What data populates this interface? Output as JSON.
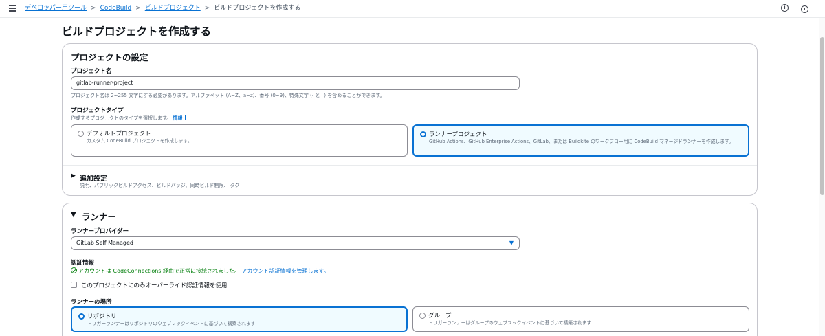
{
  "breadcrumb": {
    "items": [
      "デベロッパー用ツール",
      "CodeBuild",
      "ビルドプロジェクト"
    ],
    "current": "ビルドプロジェクトを作成する"
  },
  "page": {
    "title": "ビルドプロジェクトを作成する"
  },
  "project_settings": {
    "title": "プロジェクトの設定",
    "name_label": "プロジェクト名",
    "name_value": "gitlab-runner-project",
    "name_hint": "プロジェクト名は 2~255 文字にする必要があります。アルファベット (A~Z、a~z)、番号 (0~9)、特殊文字 (- と _) を含めることができます。",
    "type_label": "プロジェクトタイプ",
    "type_hint": "作成するプロジェクトのタイプを選択します。",
    "info_link": "情報",
    "options": [
      {
        "title": "デフォルトプロジェクト",
        "desc": "カスタム CodeBuild プロジェクトを作成します。",
        "selected": false
      },
      {
        "title": "ランナープロジェクト",
        "desc": "GitHub Actions、GitHub Enterprise Actions、GitLab、または Buildkite のワークフロー用に CodeBuild マネージドランナーを作成します。",
        "selected": true
      }
    ],
    "additional": {
      "title": "追加設定",
      "desc": "説明、パブリックビルドアクセス、ビルドバッジ、同時ビルド制限、 タグ"
    }
  },
  "runner": {
    "title": "ランナー",
    "provider_label": "ランナープロバイダー",
    "provider_value": "GitLab Self Managed",
    "credential_label": "認証情報",
    "credential_status": "アカウントは CodeConnections 経由で正常に接続されました。",
    "credential_manage": "アカウント認証情報を管理します。",
    "override_label": "このプロジェクトにのみオーバーライド認証情報を使用",
    "location_label": "ランナーの場所",
    "locations": [
      {
        "title": "リポジトリ",
        "desc": "トリガーランナーはリポジトリのウェブフックイベントに基づいて構築されます",
        "selected": true
      },
      {
        "title": "グループ",
        "desc": "トリガーランナーはグループのウェブフックイベントに基づいて構築されます",
        "selected": false
      }
    ]
  },
  "icons": {
    "menu": "menu-icon",
    "info": "info-icon",
    "notifications": "clock-icon",
    "external": "external-link-icon",
    "success": "check-circle-icon",
    "dropdown": "caret-down-icon"
  },
  "colors": {
    "link": "#0972d3",
    "success": "#037f0c",
    "selected_bg": "#f0fbff",
    "border": "#8c8c94"
  }
}
